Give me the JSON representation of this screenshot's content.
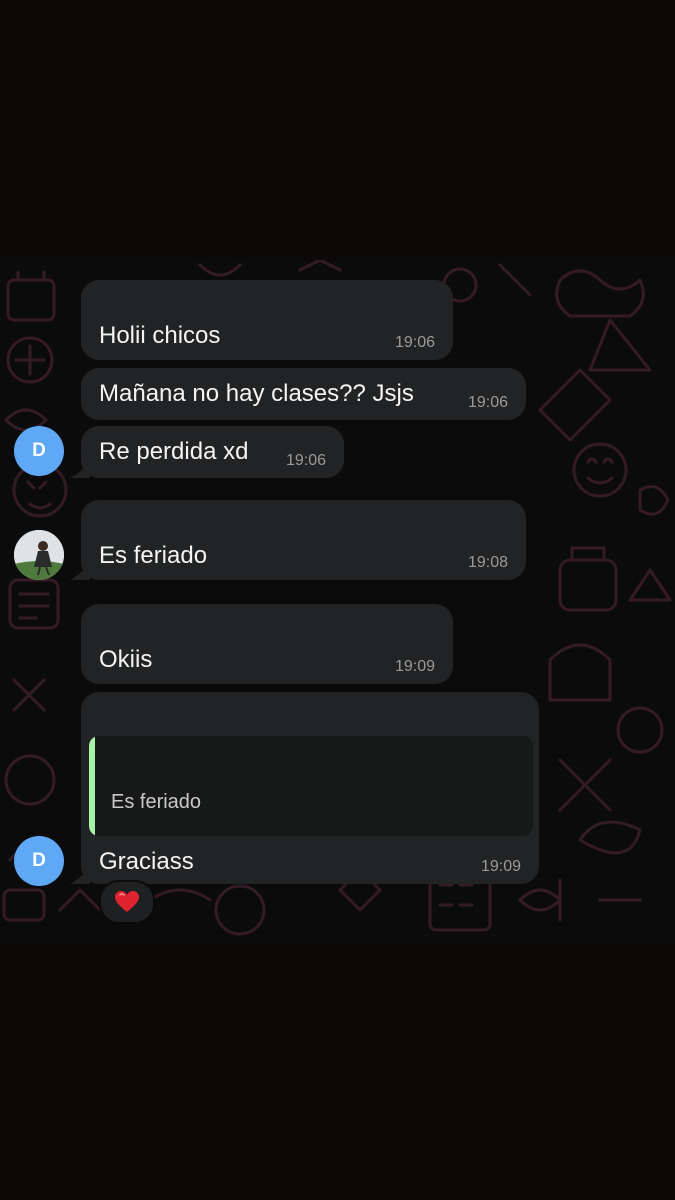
{
  "messages": [
    {
      "text": "Holii chicos",
      "time": "19:06"
    },
    {
      "text": "Mañana no hay clases?? Jsjs",
      "time": "19:06"
    },
    {
      "text": "Re perdida xd",
      "time": "19:06"
    },
    {
      "text": "Es feriado",
      "time": "19:08"
    },
    {
      "text": "Okiis",
      "time": "19:09"
    },
    {
      "text": "Graciass",
      "time": "19:09",
      "quoted_text": "Es feriado",
      "reaction": "heart"
    }
  ],
  "avatars": {
    "d_letter": "D"
  },
  "colors": {
    "bubble": "#222324",
    "avatar_blue": "#5fa8f5",
    "quote_bar": "#a7f3a5",
    "reaction_heart": "#e0242f"
  }
}
